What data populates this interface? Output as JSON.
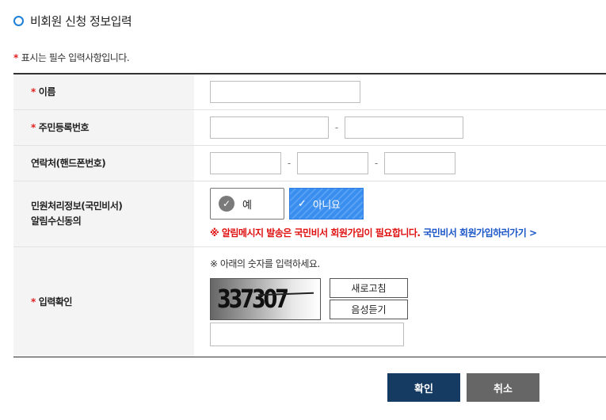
{
  "header": {
    "title": "비회원 신청 정보입력"
  },
  "notice": {
    "star": "*",
    "text": "표시는 필수 입력사항입니다."
  },
  "form": {
    "name_label": "이름",
    "rrn_label": "주민등록번호",
    "phone_label": "연락처(핸드폰번호)",
    "consent_label_line1": "민원처리정보(국민비서)",
    "consent_label_line2": "알림수신동의",
    "consent_yes": "예",
    "consent_no": "아니요",
    "consent_selected": "아니요",
    "warning_text": "※  알림메시지 발송은 국민비서 회원가입이 필요합니다.",
    "warning_link": "국민비서 회원가입하러가기 >",
    "captcha_label": "입력확인",
    "captcha_guide": "※ 아래의 숫자를 입력하세요.",
    "captcha_code": "337307",
    "refresh_button": "새로고침",
    "audio_button": "음성듣기",
    "required_star": "*",
    "dash": "-"
  },
  "actions": {
    "confirm": "확인",
    "cancel": "취소"
  }
}
